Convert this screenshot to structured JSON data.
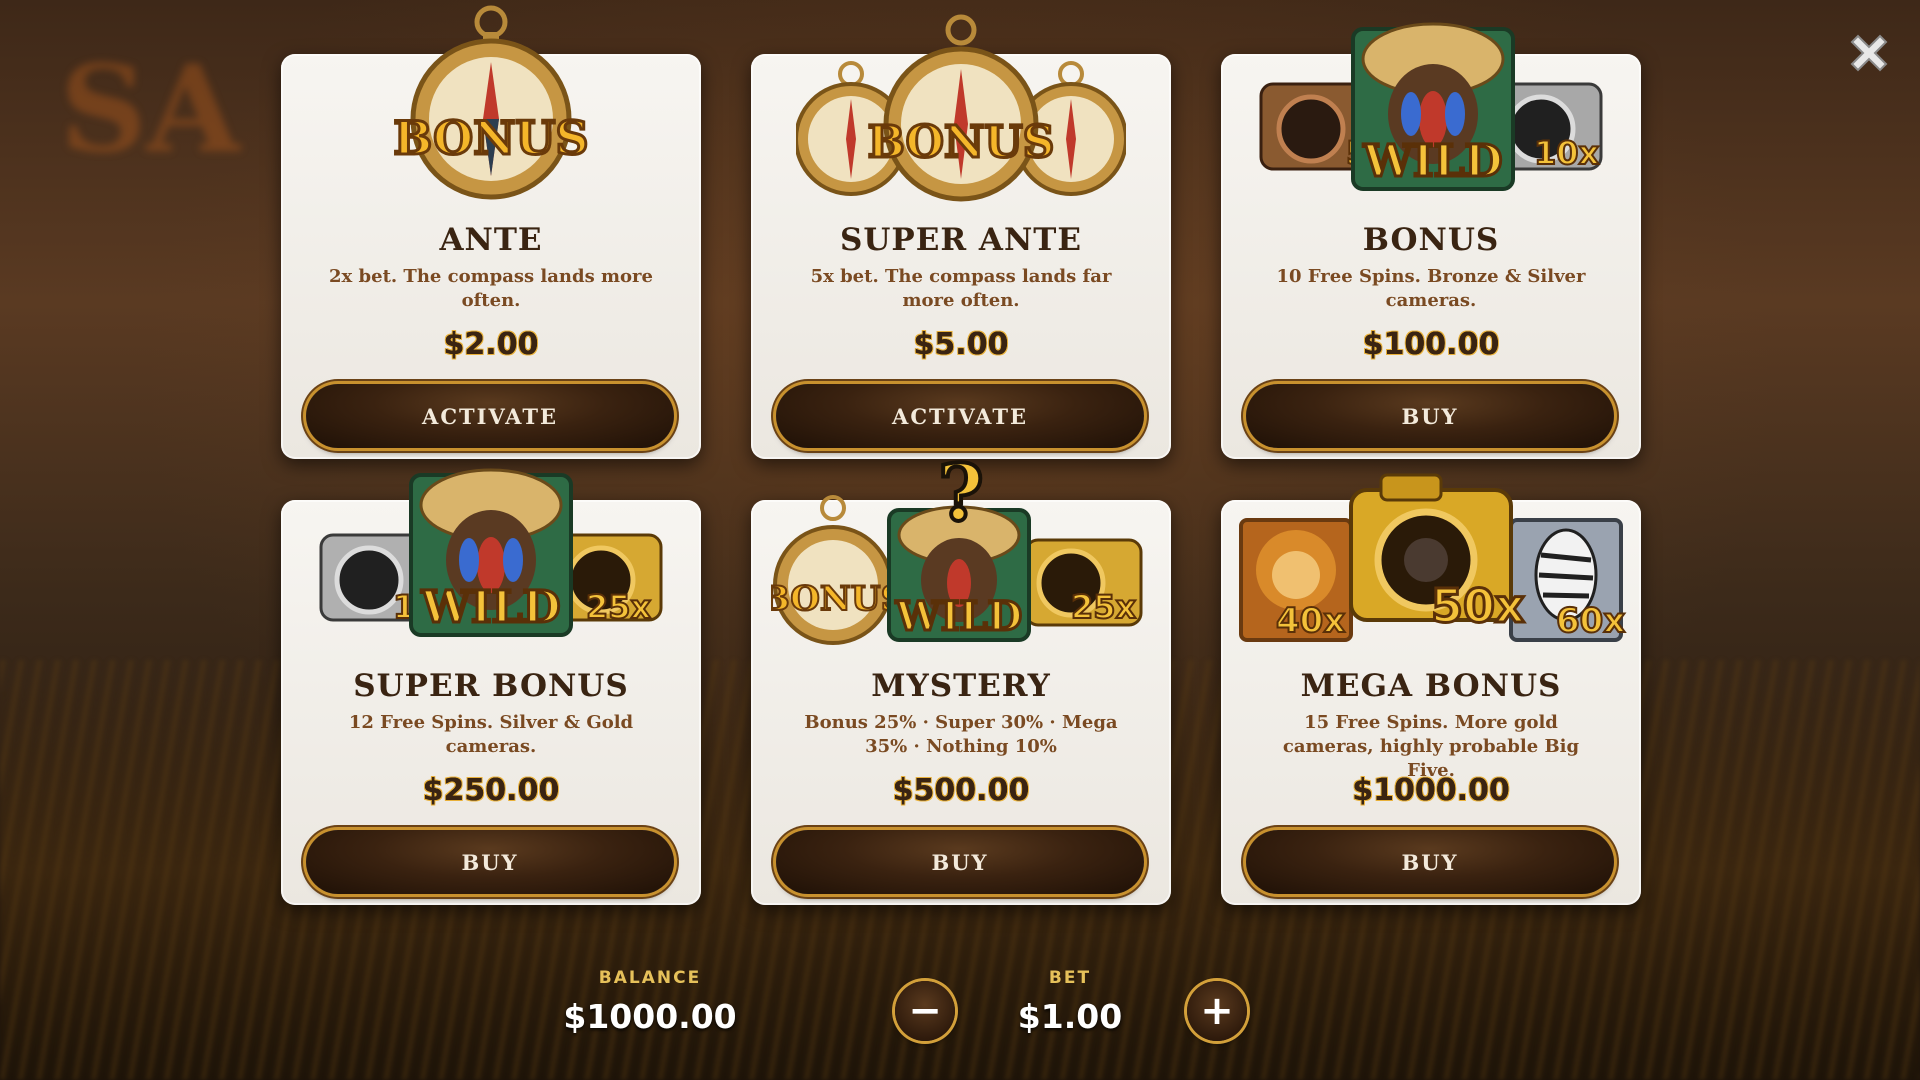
{
  "close_label": "Close",
  "cards": [
    {
      "title": "ANTE",
      "desc": "2x bet. The compass lands more often.",
      "price": "$2.00",
      "button": "ACTIVATE"
    },
    {
      "title": "SUPER ANTE",
      "desc": "5x bet. The compass lands far more often.",
      "price": "$5.00",
      "button": "ACTIVATE"
    },
    {
      "title": "BONUS",
      "desc": "10 Free Spins. Bronze & Silver cameras.",
      "price": "$100.00",
      "button": "BUY",
      "badges": [
        "5x",
        "10x"
      ],
      "wild": "WILD"
    },
    {
      "title": "SUPER BONUS",
      "desc": "12 Free Spins. Silver & Gold cameras.",
      "price": "$250.00",
      "button": "BUY",
      "badges": [
        "10",
        "25x"
      ],
      "wild": "WILD"
    },
    {
      "title": "MYSTERY",
      "desc": "Bonus 25% · Super 30% · Mega 35% · Nothing 10%",
      "price": "$500.00",
      "button": "BUY",
      "badges": [
        "25x"
      ],
      "wild": "WILD",
      "bonus_text": "BONUS"
    },
    {
      "title": "MEGA BONUS",
      "desc": "15 Free Spins. More gold cameras, highly probable Big Five.",
      "price": "$1000.00",
      "button": "BUY",
      "badges": [
        "40x",
        "50x",
        "60x"
      ]
    }
  ],
  "compass_label": "BONUS",
  "footer": {
    "balance_label": "BALANCE",
    "balance_value": "$1000.00",
    "bet_label": "BET",
    "bet_value": "$1.00",
    "minus_symbol": "−",
    "plus_symbol": "+"
  },
  "colors": {
    "card_bg": "#f3f0ea",
    "title": "#3a2412",
    "desc": "#7a4a22",
    "button_bg": "#2e1a0c",
    "button_ring": "#c8912e",
    "label_gold": "#e6c15a"
  }
}
